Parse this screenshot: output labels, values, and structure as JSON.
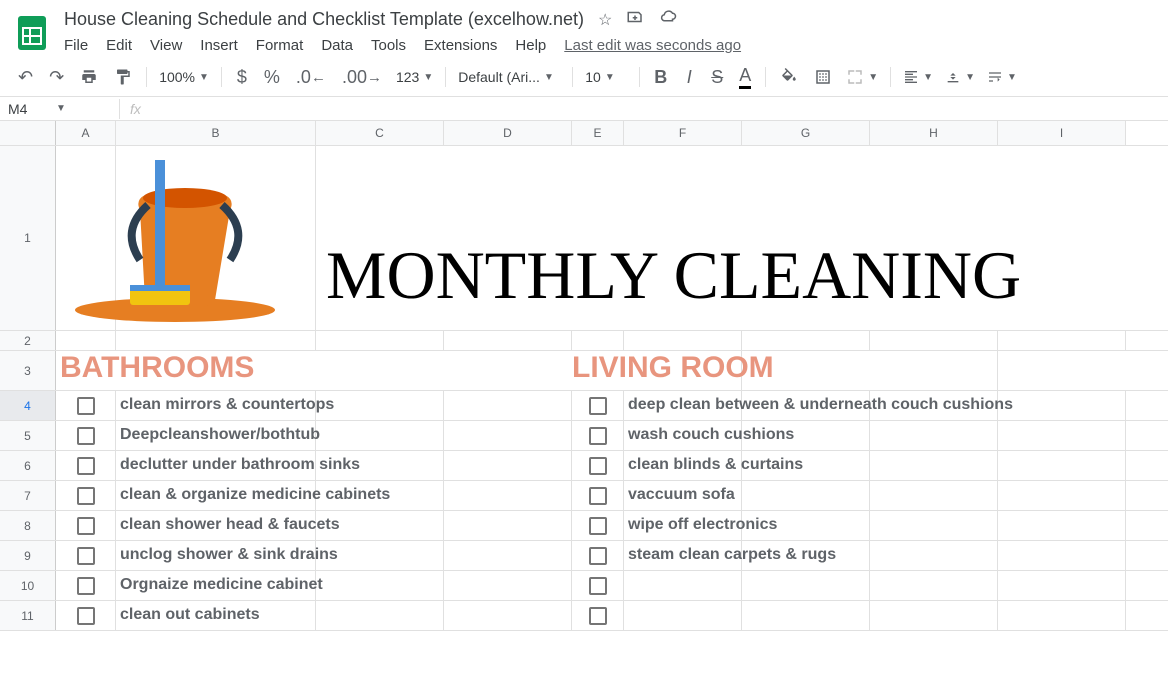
{
  "document": {
    "title": "House Cleaning Schedule and Checklist Template (excelhow.net)",
    "lastEdit": "Last edit was seconds ago"
  },
  "menu": {
    "file": "File",
    "edit": "Edit",
    "view": "View",
    "insert": "Insert",
    "format": "Format",
    "data": "Data",
    "tools": "Tools",
    "extensions": "Extensions",
    "help": "Help"
  },
  "toolbar": {
    "zoom": "100%",
    "font": "Default (Ari...",
    "fontSize": "10"
  },
  "formulaBar": {
    "cellRef": "M4",
    "value": ""
  },
  "columns": [
    "A",
    "B",
    "C",
    "D",
    "E",
    "F",
    "G",
    "H",
    "I"
  ],
  "rowNumbers": [
    "1",
    "2",
    "3",
    "4",
    "5",
    "6",
    "7",
    "8",
    "9",
    "10",
    "11"
  ],
  "content": {
    "mainTitle": "MONTHLY CLEANING",
    "sections": {
      "bathrooms": {
        "title": "BATHROOMS",
        "tasks": [
          "clean mirrors & countertops",
          "Deepcleanshower/bothtub",
          "declutter under bathroom sinks",
          "clean & organize medicine cabinets",
          "clean shower head & faucets",
          "unclog shower & sink drains",
          "Orgnaize medicine cabinet",
          "clean out cabinets"
        ]
      },
      "livingRoom": {
        "title": "LIVING ROOM",
        "tasks": [
          "deep clean between & underneath couch cushions",
          "wash couch cushions",
          "clean blinds & curtains",
          "vaccuum sofa",
          "wipe off electronics",
          "steam clean carpets & rugs",
          "",
          ""
        ]
      }
    }
  }
}
